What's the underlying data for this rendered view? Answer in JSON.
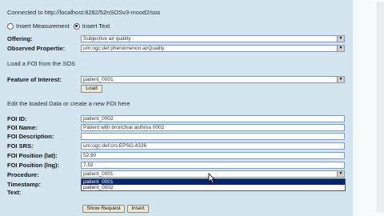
{
  "status": {
    "connected": "Connected to http://localhost:8282/52nSOSv3-mood2/sos"
  },
  "mode": {
    "measurement_label": "Insert Measurement",
    "text_label": "Insert Text",
    "selected": "text"
  },
  "form1": {
    "offering_label": "Offering:",
    "offering_value": "Subjective air quality",
    "observed_label": "Observed Propertie:",
    "observed_value": "urn:ogc:def:phenomenon:airQuality"
  },
  "foi_load": {
    "section_title": "Load a FOI from the SOS",
    "foi_label": "Feature of Interest:",
    "foi_value": "patient_0001",
    "load_button": "Load"
  },
  "edit": {
    "section_title": "Edit the loaded Data or create a new FOI here",
    "rows": [
      {
        "label": "FOI ID:",
        "value": "patient_0002"
      },
      {
        "label": "FOI Name:",
        "value": "Patient with bronchial asthma 0002"
      },
      {
        "label": "FOI Description:",
        "value": ""
      },
      {
        "label": "FOI SRS:",
        "value": "urn:ogc:def:crs:EPSG:4326"
      },
      {
        "label": "FOI Position (lat):",
        "value": "52.90"
      },
      {
        "label": "FOI Position (lng):",
        "value": "7.52"
      }
    ],
    "procedure_label": "Procedure:",
    "procedure_value": "patient_0001",
    "timestamp_label": "Timestamp:",
    "text_label": "Text:",
    "procedure_options": [
      "patient_0001",
      "patient_0002"
    ]
  },
  "buttons": {
    "show_request": "Show Request",
    "insert": "Insert"
  },
  "icons": {
    "select_arrow": "chevron-down-icon",
    "cursor": "mouse-pointer-icon"
  }
}
